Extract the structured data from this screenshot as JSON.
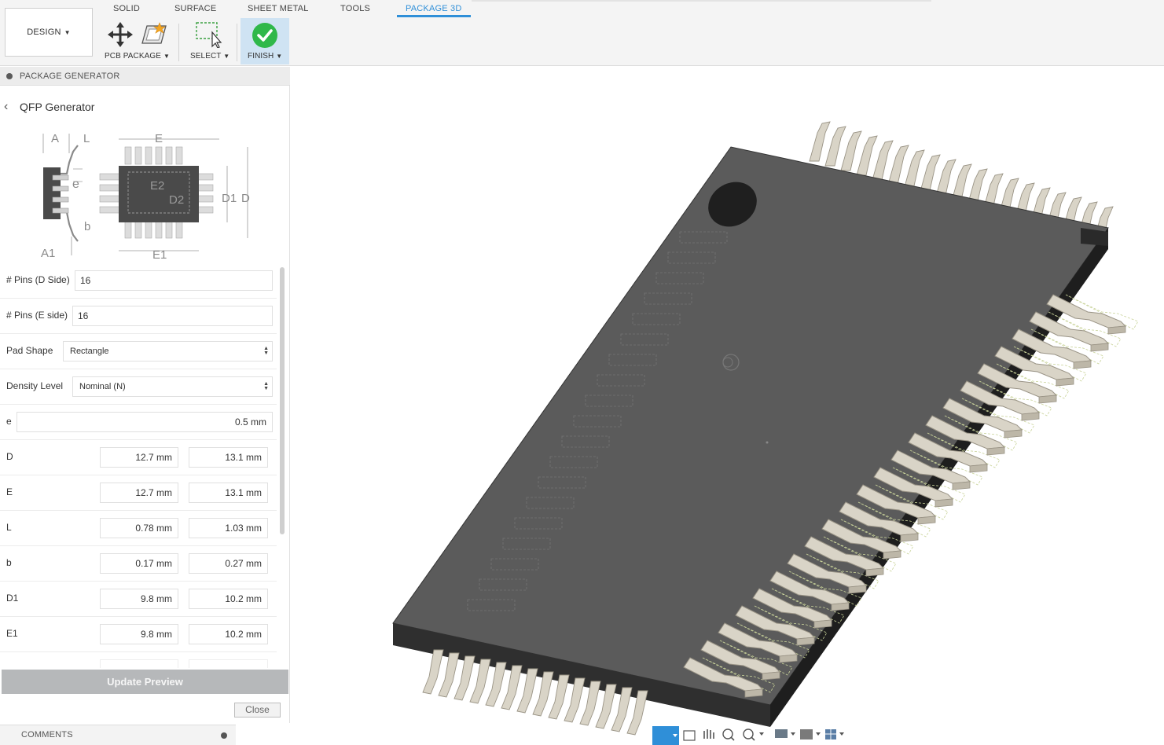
{
  "toolbar": {
    "design_label": "DESIGN",
    "tabs": [
      {
        "label": "SOLID"
      },
      {
        "label": "SURFACE"
      },
      {
        "label": "SHEET METAL"
      },
      {
        "label": "TOOLS"
      },
      {
        "label": "PACKAGE 3D",
        "active": true
      }
    ],
    "groups": {
      "pcb_package": "PCB PACKAGE",
      "select": "SELECT",
      "finish": "FINISH"
    }
  },
  "panel": {
    "header": "PACKAGE GENERATOR",
    "title": "QFP Generator",
    "diagram_labels": {
      "A": "A",
      "L": "L",
      "e": "e",
      "b": "b",
      "A1": "A1",
      "E": "E",
      "E2": "E2",
      "D2": "D2",
      "D1": "D1",
      "D": "D",
      "E1": "E1"
    },
    "fields": {
      "pins_d": {
        "label": "# Pins (D Side)",
        "value": "16"
      },
      "pins_e": {
        "label": "# Pins (E side)",
        "value": "16"
      },
      "pad_shape": {
        "label": "Pad Shape",
        "value": "Rectangle"
      },
      "density": {
        "label": "Density Level",
        "value": "Nominal (N)"
      },
      "e": {
        "label": "e",
        "value": "0.5 mm"
      }
    },
    "ranges": [
      {
        "label": "D",
        "min": "12.7 mm",
        "max": "13.1 mm"
      },
      {
        "label": "E",
        "min": "12.7 mm",
        "max": "13.1 mm"
      },
      {
        "label": "L",
        "min": "0.78 mm",
        "max": "1.03 mm"
      },
      {
        "label": "b",
        "min": "0.17 mm",
        "max": "0.27 mm"
      },
      {
        "label": "D1",
        "min": "9.8 mm",
        "max": "10.2 mm"
      },
      {
        "label": "E1",
        "min": "9.8 mm",
        "max": "10.2 mm"
      }
    ],
    "update_label": "Update Preview",
    "close_label": "Close"
  },
  "comments_label": "COMMENTS",
  "colors": {
    "accent": "#2f8fd8",
    "finish_bg": "#cfe3f3",
    "finish_check": "#2fb84a",
    "chip_body": "#5b5b5b",
    "chip_edge": "#2a2a2a",
    "lead": "#d9d4c7"
  },
  "icons": [
    "move-icon",
    "pcb-package-icon",
    "select-icon",
    "finish-check-icon",
    "orbit-icon",
    "pan-icon",
    "zoom-icon",
    "display-icon",
    "grid-icon"
  ]
}
